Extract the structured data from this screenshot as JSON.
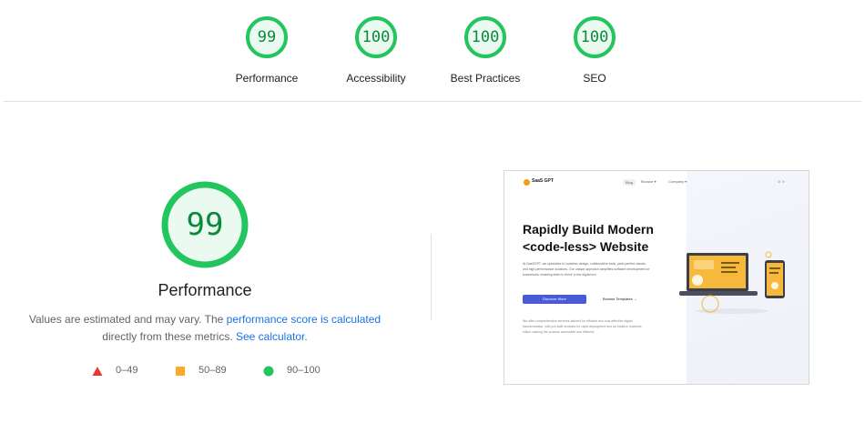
{
  "categories": [
    {
      "label": "Performance",
      "score": "99",
      "value": 99
    },
    {
      "label": "Accessibility",
      "score": "100",
      "value": 100
    },
    {
      "label": "Best Practices",
      "score": "100",
      "value": 100
    },
    {
      "label": "SEO",
      "score": "100",
      "value": 100
    }
  ],
  "main": {
    "score": "99",
    "value": 99,
    "title": "Performance",
    "desc_prefix": "Values are estimated and may vary. The ",
    "desc_link1": "performance score is calculated",
    "desc_middle": " directly from these metrics. ",
    "desc_link2": "See calculator",
    "desc_suffix": "."
  },
  "legend": [
    {
      "range": "0–49",
      "shape": "triangle",
      "color": "#e53935"
    },
    {
      "range": "50–89",
      "shape": "square",
      "color": "#ffa726"
    },
    {
      "range": "90–100",
      "shape": "circle",
      "color": "#22c55e"
    }
  ],
  "colors": {
    "pass_ring": "#22c55e",
    "pass_fill": "#eafaf0",
    "pass_text": "#0c8a3b",
    "link": "#1a73e8"
  },
  "screenshot": {
    "logo": "SaaS GPT",
    "nav_items": [
      "Blog",
      "Browse ▾",
      "Company ▾"
    ],
    "nav_icons": "⊘ ⊙",
    "headline_1": "Rapidly Build Modern",
    "headline_2": "<code-less> Website",
    "paragraph": "At SaaSGPT, we specialize in codeless design, collaborative tools, pixel-perfect visuals, and high-performance solutions. Our unique approach simplifies software development for businesses, enabling them to thrive in the digital era.",
    "primary_button": "Discover More",
    "secondary_button": "Browse Templates →",
    "paragraph_2": "We offer comprehensive services tailored for efficient and cost-effective digital transformation, with pre-built modules for rapid deployment and an intuitive codeless editor, making the process accessible and efficient."
  }
}
